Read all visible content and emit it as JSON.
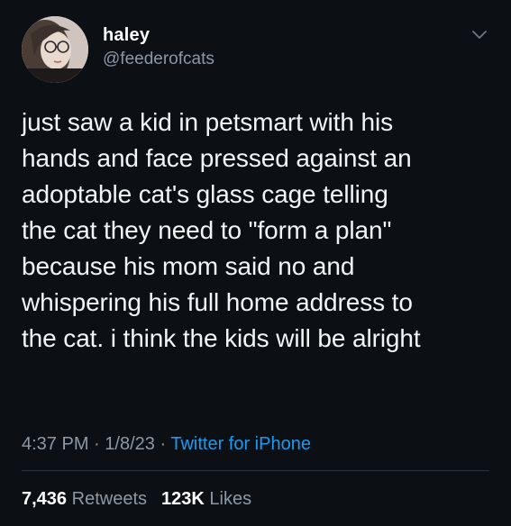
{
  "user": {
    "display_name": "haley",
    "handle": "@feederofcats"
  },
  "tweet": {
    "text": "just saw a kid in petsmart with his\nhands and face pressed against an\nadoptable cat's glass cage telling\nthe cat they need to \"form a plan\"\nbecause his mom said no and\nwhispering his full home address to\nthe cat. i think the kids will be alright"
  },
  "meta": {
    "time": "4:37 PM",
    "separator": "·",
    "date": "1/8/23",
    "source": "Twitter for iPhone"
  },
  "stats": {
    "retweets_count": "7,436",
    "retweets_label": "Retweets",
    "likes_count": "123K",
    "likes_label": "Likes"
  },
  "icons": {
    "more": "chevron-down-icon",
    "avatar": "profile-photo"
  },
  "colors": {
    "background": "#0c0f14",
    "text": "#ffffff",
    "muted": "#8b98a5",
    "link": "#1d9bf0"
  }
}
